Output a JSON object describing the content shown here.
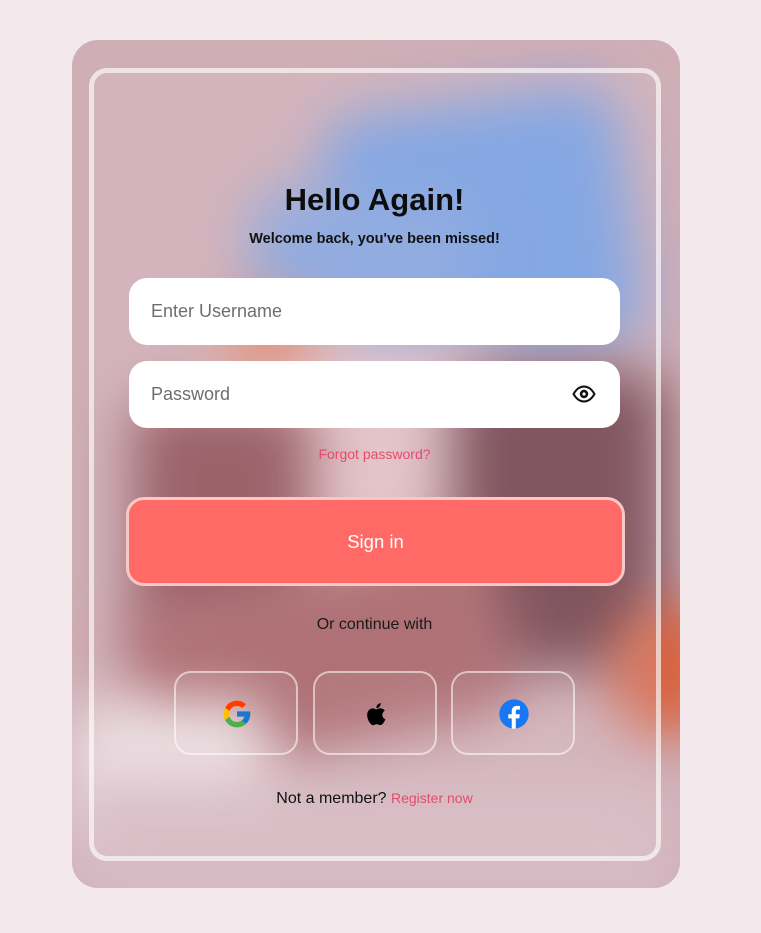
{
  "header": {
    "title": "Hello Again!",
    "subtitle": "Welcome back, you've been missed!"
  },
  "form": {
    "username_placeholder": "Enter Username",
    "username_value": "",
    "password_placeholder": "Password",
    "password_value": "",
    "forgot_label": "Forgot password?",
    "signin_label": "Sign in"
  },
  "social": {
    "divider_label": "Or continue with",
    "providers": [
      "google-icon",
      "apple-icon",
      "facebook-icon"
    ]
  },
  "footer": {
    "prompt": "Not a member?",
    "register_label": "Register now"
  },
  "colors": {
    "accent": "#ff6a67",
    "link": "#e24c6b",
    "background": "#f3e8ec"
  }
}
